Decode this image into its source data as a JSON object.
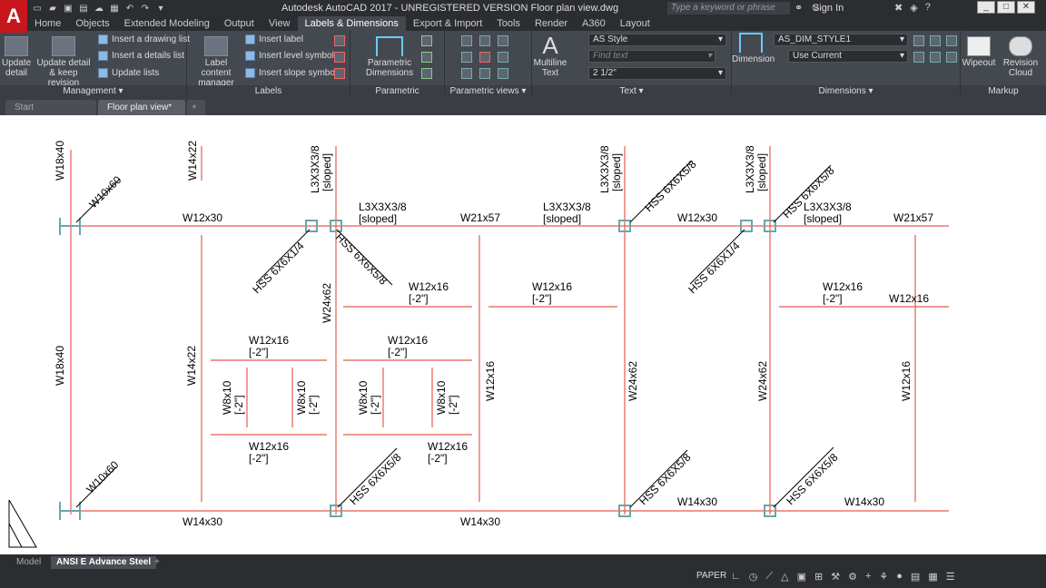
{
  "app": {
    "logo": "A",
    "title": "Autodesk AutoCAD 2017 - UNREGISTERED VERSION    Floor plan view.dwg",
    "search_placeholder": "Type a keyword or phrase",
    "sign_in": "Sign In"
  },
  "ribbon_tabs": [
    "Home",
    "Objects",
    "Extended Modeling",
    "Output",
    "View",
    "Labels & Dimensions",
    "Export & Import",
    "Tools",
    "Render",
    "A360",
    "Layout"
  ],
  "ribbon": {
    "management": {
      "label": "Management",
      "update_detail": "Update detail",
      "update_keep": "Update detail & keep revision",
      "insert_drawing_list": "Insert a drawing list",
      "insert_details_list": "Insert a details list",
      "update_lists": "Update lists"
    },
    "labels": {
      "label": "Labels",
      "label_content_manager": "Label content manager",
      "insert_label": "Insert label",
      "insert_level_symbol": "Insert level symbol",
      "insert_slope_symbol": "Insert slope symbol"
    },
    "parametric_dimensions": {
      "label": "Parametric Dimensions",
      "btn": "Parametric Dimensions"
    },
    "parametric_views": {
      "label": "Parametric views"
    },
    "text": {
      "label": "Text",
      "multiline": "Multiline Text",
      "style": "AS Style",
      "find": "Find text",
      "height": "2 1/2\""
    },
    "dimensions": {
      "label": "Dimensions",
      "dimension": "Dimension",
      "dimstyle": "AS_DIM_STYLE1",
      "use_current": "Use Current"
    },
    "markup": {
      "label": "Markup",
      "wipeout": "Wipeout",
      "revision_cloud": "Revision Cloud"
    }
  },
  "doc_tabs": [
    "Start",
    "Floor plan view*"
  ],
  "drawing": {
    "labels": {
      "w18x40": "W18x40",
      "w10x60": "W10x60",
      "w14x22": "W14x22",
      "w12x30": "W12x30",
      "l3x3": "L3X3X3/8",
      "sloped": "[sloped]",
      "w21x57": "W21x57",
      "hss6x6x5_8": "HSS 6X6X5/8",
      "hss6x6x1_4": "HSS 6X6X1/4",
      "w24x62": "W24x62",
      "w12x16": "W12x16",
      "m2": "[-2\"]",
      "w8x10": "W8x10",
      "w14x30": "W14x30"
    }
  },
  "status": {
    "model": "Model",
    "layout": "ANSI E Advance Steel",
    "paper": "PAPER"
  }
}
